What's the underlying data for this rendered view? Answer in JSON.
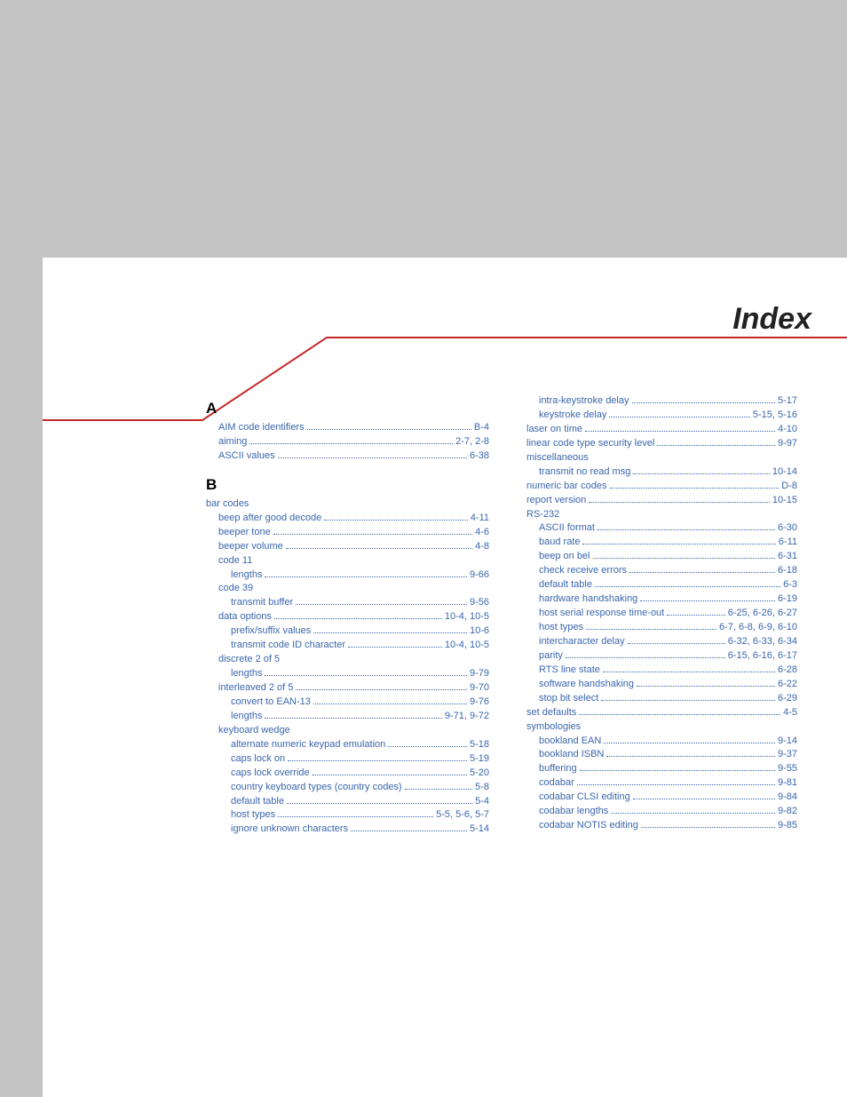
{
  "title": "Index",
  "left": {
    "A": [
      {
        "label": "AIM code identifiers",
        "page": "B-4",
        "link": true,
        "indent": 1
      },
      {
        "label": "aiming",
        "page": "2-7, 2-8",
        "link": true,
        "indent": 1
      },
      {
        "label": "ASCII values",
        "page": "6-38",
        "link": true,
        "indent": 1
      }
    ],
    "B": [
      {
        "label": "bar codes",
        "page": "",
        "link": true,
        "indent": 0,
        "noleader": true
      },
      {
        "label": "beep after good decode",
        "page": "4-11",
        "link": true,
        "indent": 1
      },
      {
        "label": "beeper tone",
        "page": "4-6",
        "link": true,
        "indent": 1
      },
      {
        "label": "beeper volume",
        "page": "4-8",
        "link": true,
        "indent": 1
      },
      {
        "label": "code 11",
        "page": "",
        "link": true,
        "indent": 1,
        "noleader": true
      },
      {
        "label": "lengths",
        "page": "9-66",
        "link": true,
        "indent": 2
      },
      {
        "label": "code 39",
        "page": "",
        "link": true,
        "indent": 1,
        "noleader": true
      },
      {
        "label": "transmit buffer",
        "page": "9-56",
        "link": true,
        "indent": 2
      },
      {
        "label": "data options",
        "page": "10-4, 10-5",
        "link": true,
        "indent": 1
      },
      {
        "label": "prefix/suffix values",
        "page": "10-6",
        "link": true,
        "indent": 2
      },
      {
        "label": "transmit code ID character",
        "page": "10-4, 10-5",
        "link": true,
        "indent": 2
      },
      {
        "label": "discrete 2 of 5",
        "page": "",
        "link": true,
        "indent": 1,
        "noleader": true
      },
      {
        "label": "lengths",
        "page": "9-79",
        "link": true,
        "indent": 2
      },
      {
        "label": "interleaved 2 of 5",
        "page": "9-70",
        "link": true,
        "indent": 1
      },
      {
        "label": "convert to EAN-13",
        "page": "9-76",
        "link": true,
        "indent": 2
      },
      {
        "label": "lengths",
        "page": "9-71, 9-72",
        "link": true,
        "indent": 2
      },
      {
        "label": "keyboard wedge",
        "page": "",
        "link": true,
        "indent": 1,
        "noleader": true
      },
      {
        "label": "alternate numeric keypad emulation",
        "page": "5-18",
        "link": true,
        "indent": 2
      },
      {
        "label": "caps lock on",
        "page": "5-19",
        "link": true,
        "indent": 2
      },
      {
        "label": "caps lock override",
        "page": "5-20",
        "link": true,
        "indent": 2
      },
      {
        "label": "country keyboard types (country codes)",
        "page": "5-8",
        "link": true,
        "indent": 2
      },
      {
        "label": "default table",
        "page": "5-4",
        "link": true,
        "indent": 2
      },
      {
        "label": "host types",
        "page": "5-5, 5-6, 5-7",
        "link": true,
        "indent": 2
      },
      {
        "label": "ignore unknown characters",
        "page": "5-14",
        "link": true,
        "indent": 2
      }
    ]
  },
  "right": [
    {
      "label": "intra-keystroke delay",
      "page": "5-17",
      "link": true,
      "indent": 2
    },
    {
      "label": "keystroke delay",
      "page": "5-15, 5-16",
      "link": true,
      "indent": 2
    },
    {
      "label": "laser on time",
      "page": "4-10",
      "link": true,
      "indent": 1
    },
    {
      "label": "linear code type security level",
      "page": "9-97",
      "link": true,
      "indent": 1
    },
    {
      "label": "miscellaneous",
      "page": "",
      "link": true,
      "indent": 1,
      "noleader": true
    },
    {
      "label": "transmit no read msg",
      "page": "10-14",
      "link": true,
      "indent": 2
    },
    {
      "label": "numeric bar codes",
      "page": "D-8",
      "link": true,
      "indent": 1
    },
    {
      "label": "report version",
      "page": "10-15",
      "link": true,
      "indent": 1
    },
    {
      "label": "RS-232",
      "page": "",
      "link": true,
      "indent": 1,
      "noleader": true
    },
    {
      "label": "ASCII format",
      "page": "6-30",
      "link": true,
      "indent": 2
    },
    {
      "label": "baud rate",
      "page": "6-11",
      "link": true,
      "indent": 2
    },
    {
      "label": "beep on bel",
      "page": "6-31",
      "link": true,
      "indent": 2
    },
    {
      "label": "check receive errors",
      "page": "6-18",
      "link": true,
      "indent": 2
    },
    {
      "label": "default table",
      "page": "6-3",
      "link": true,
      "indent": 2
    },
    {
      "label": "hardware handshaking",
      "page": "6-19",
      "link": true,
      "indent": 2
    },
    {
      "label": "host serial response time-out",
      "page": "6-25, 6-26, 6-27",
      "link": true,
      "indent": 2
    },
    {
      "label": "host types",
      "page": "6-7, 6-8, 6-9, 6-10",
      "link": true,
      "indent": 2
    },
    {
      "label": "intercharacter delay",
      "page": "6-32, 6-33, 6-34",
      "link": true,
      "indent": 2
    },
    {
      "label": "parity",
      "page": "6-15, 6-16, 6-17",
      "link": true,
      "indent": 2
    },
    {
      "label": "RTS line state",
      "page": "6-28",
      "link": true,
      "indent": 2
    },
    {
      "label": "software handshaking",
      "page": "6-22",
      "link": true,
      "indent": 2
    },
    {
      "label": "stop bit select",
      "page": "6-29",
      "link": true,
      "indent": 2
    },
    {
      "label": "set defaults",
      "page": "4-5",
      "link": true,
      "indent": 1
    },
    {
      "label": "symbologies",
      "page": "",
      "link": true,
      "indent": 1,
      "noleader": true
    },
    {
      "label": "bookland EAN",
      "page": "9-14",
      "link": true,
      "indent": 2
    },
    {
      "label": "bookland ISBN",
      "page": "9-37",
      "link": true,
      "indent": 2
    },
    {
      "label": "buffering",
      "page": "9-55",
      "link": true,
      "indent": 2
    },
    {
      "label": "codabar",
      "page": "9-81",
      "link": true,
      "indent": 2
    },
    {
      "label": "codabar CLSI editing",
      "page": "9-84",
      "link": true,
      "indent": 2
    },
    {
      "label": "codabar lengths",
      "page": "9-82",
      "link": true,
      "indent": 2
    },
    {
      "label": "codabar NOTIS editing",
      "page": "9-85",
      "link": true,
      "indent": 2
    }
  ]
}
